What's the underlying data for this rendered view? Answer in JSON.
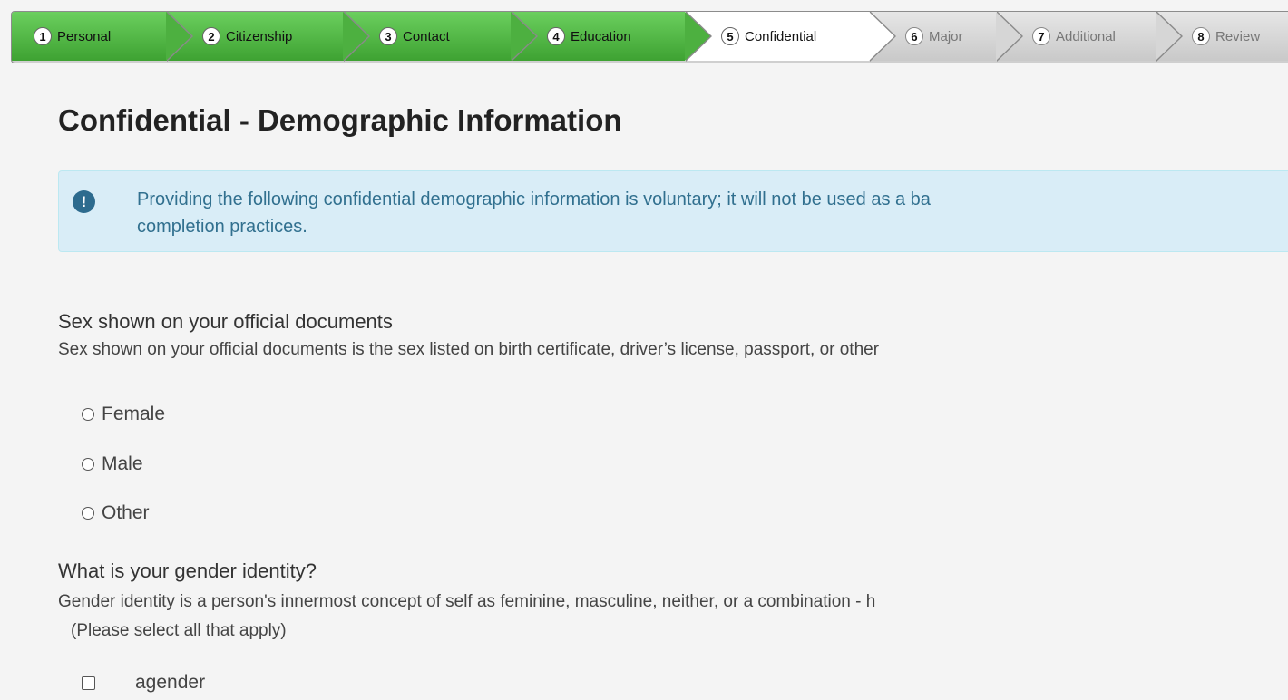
{
  "steps": [
    {
      "num": "1",
      "label": "Personal",
      "state": "done"
    },
    {
      "num": "2",
      "label": "Citizenship",
      "state": "done"
    },
    {
      "num": "3",
      "label": "Contact",
      "state": "done"
    },
    {
      "num": "4",
      "label": "Education",
      "state": "done"
    },
    {
      "num": "5",
      "label": "Confidential",
      "state": "active"
    },
    {
      "num": "6",
      "label": "Major",
      "state": "todo"
    },
    {
      "num": "7",
      "label": "Additional",
      "state": "todo"
    },
    {
      "num": "8",
      "label": "Review",
      "state": "todo"
    }
  ],
  "page": {
    "title": "Confidential - Demographic Information"
  },
  "notice": {
    "icon": "exclamation-icon",
    "line1": "Providing the following confidential demographic information is voluntary; it will not be used as a ba",
    "line2": "completion practices."
  },
  "sex": {
    "title": "Sex shown on your official documents",
    "help": "Sex shown on your official documents is the sex listed on birth certificate, driver’s license, passport, or other",
    "options": [
      "Female",
      "Male",
      "Other"
    ]
  },
  "gender": {
    "title": "What is your gender identity?",
    "help": "Gender identity is a person's innermost concept of self as feminine, masculine, neither, or a combination - h",
    "note": "(Please select all that apply)",
    "options": [
      "agender"
    ]
  },
  "colors": {
    "done": "#4db040",
    "active": "#ffffff",
    "todo": "#d6d6d6",
    "notice_bg": "#d9edf7",
    "notice_text": "#31708f"
  }
}
